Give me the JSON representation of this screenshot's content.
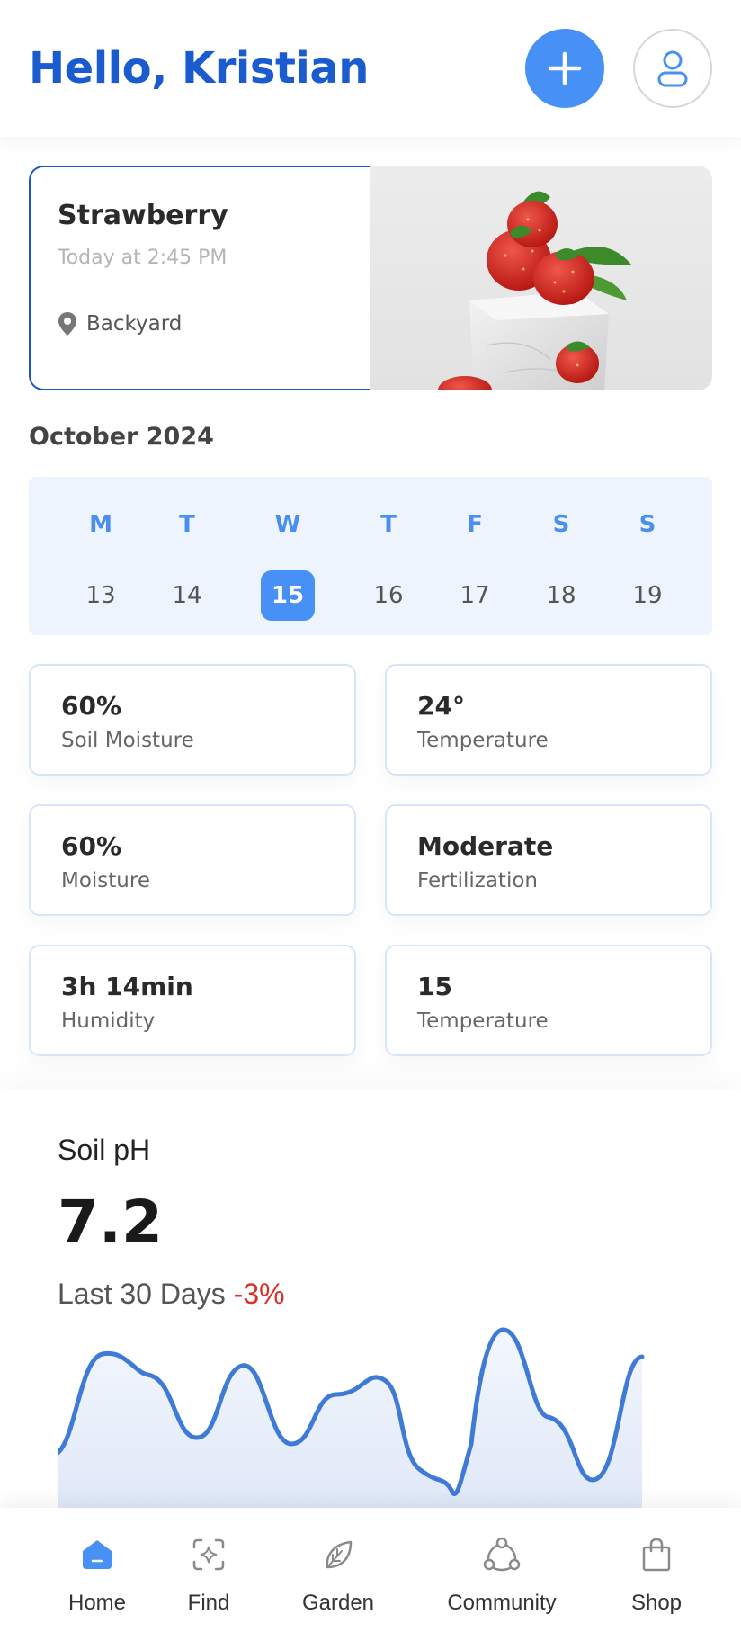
{
  "header": {
    "greeting": "Hello, Kristian",
    "add_icon": "plus-icon",
    "profile_icon": "user-icon"
  },
  "plant_card": {
    "name": "Strawberry",
    "time": "Today at 2:45 PM",
    "location": "Backyard",
    "location_icon": "location-pin-icon"
  },
  "calendar": {
    "month": "October 2024",
    "days": [
      {
        "day": "M",
        "date": "13",
        "selected": false
      },
      {
        "day": "T",
        "date": "14",
        "selected": false
      },
      {
        "day": "W",
        "date": "15",
        "selected": true
      },
      {
        "day": "T",
        "date": "16",
        "selected": false
      },
      {
        "day": "F",
        "date": "17",
        "selected": false
      },
      {
        "day": "S",
        "date": "18",
        "selected": false
      },
      {
        "day": "S",
        "date": "19",
        "selected": false
      }
    ]
  },
  "stats": [
    {
      "value": "60%",
      "label": "Soil Moisture"
    },
    {
      "value": "24°",
      "label": "Temperature"
    },
    {
      "value": "60%",
      "label": "Moisture"
    },
    {
      "value": "Moderate",
      "label": "Fertilization"
    },
    {
      "value": "3h 14min",
      "label": "Humidity"
    },
    {
      "value": "15",
      "label": "Temperature"
    }
  ],
  "soil_ph": {
    "title": "Soil pH",
    "value": "7.2",
    "period": "Last 30 Days",
    "change": "-3%",
    "change_color": "#d9302a",
    "line_color": "#3f7bd6"
  },
  "bottom_nav": [
    {
      "label": "Home",
      "icon": "home-icon",
      "active": true
    },
    {
      "label": "Find",
      "icon": "scan-icon",
      "active": false
    },
    {
      "label": "Garden",
      "icon": "leaf-icon",
      "active": false
    },
    {
      "label": "Community",
      "icon": "community-icon",
      "active": false
    },
    {
      "label": "Shop",
      "icon": "shopping-bag-icon",
      "active": false
    }
  ],
  "colors": {
    "brand": "#1a5bd0",
    "accent": "#4790f5",
    "calendar_bg": "#eef4fd"
  }
}
